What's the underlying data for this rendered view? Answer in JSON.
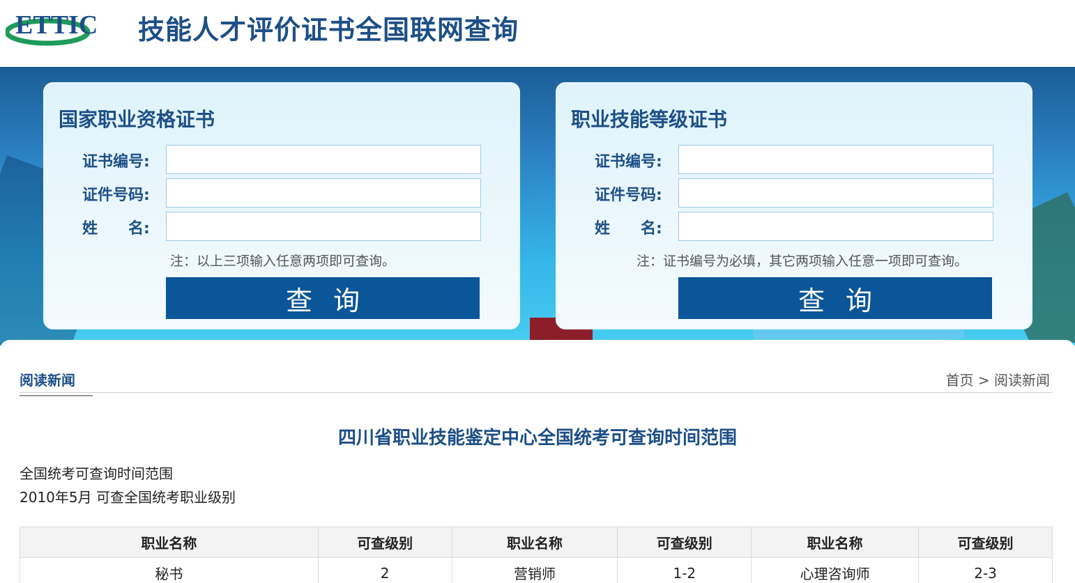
{
  "header": {
    "logo_text": "ETTIC",
    "site_title": "技能人才评价证书全国联网查询"
  },
  "panel_left": {
    "title": "国家职业资格证书",
    "label_cert_no": "证书编号:",
    "label_id_no": "证件号码:",
    "label_name": "姓　　名:",
    "note": "注：以上三项输入任意两项即可查询。",
    "button": "查询"
  },
  "panel_right": {
    "title": "职业技能等级证书",
    "label_cert_no": "证书编号:",
    "label_id_no": "证件号码:",
    "label_name": "姓　　名:",
    "note": "注：证书编号为必填，其它两项输入任意一项即可查询。",
    "button": "查询"
  },
  "content": {
    "section_tab": "阅读新闻",
    "breadcrumb_home": "首页",
    "breadcrumb_sep": ">",
    "breadcrumb_current": "阅读新闻",
    "article_title": "四川省职业技能鉴定中心全国统考可查询时间范围",
    "para1": "全国统考可查询时间范围",
    "para2": "2010年5月 可查全国统考职业级别"
  },
  "table": {
    "headers": [
      "职业名称",
      "可查级别",
      "职业名称",
      "可查级别",
      "职业名称",
      "可查级别"
    ],
    "rows": [
      [
        "秘书",
        "2",
        "营销师",
        "1-2",
        "心理咨询师",
        "2-3"
      ]
    ]
  },
  "colors": {
    "brand": "#1d4f86",
    "button": "#0b5599",
    "logo_green": "#1f9b5a"
  }
}
